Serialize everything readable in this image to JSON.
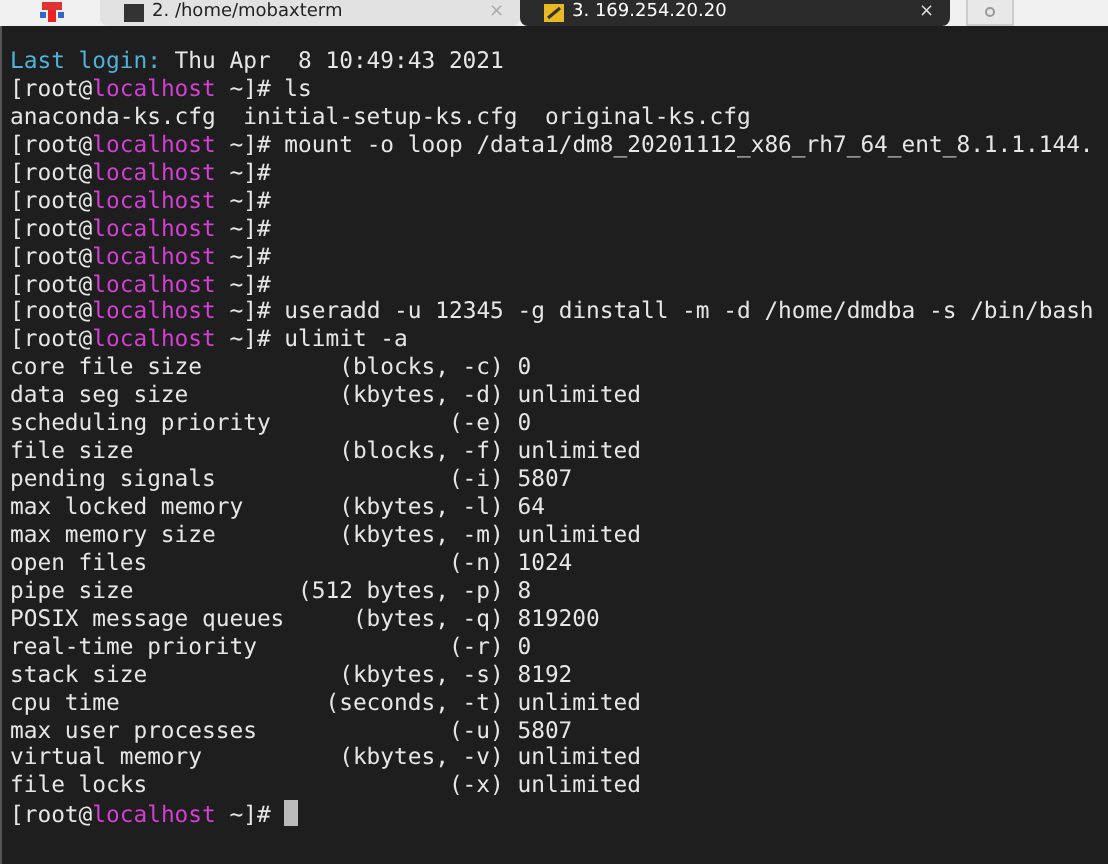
{
  "tabs": [
    {
      "label": "2. /home/mobaxterm",
      "close": "×",
      "selected": false
    },
    {
      "label": "3. 169.254.20.20",
      "close": "×",
      "selected": true
    }
  ],
  "terminal": {
    "lines": [
      {
        "kind": "login",
        "label": "Last login:",
        "text": " Thu Apr  8 10:49:43 2021"
      },
      {
        "kind": "prompt",
        "user": "[root@",
        "host": "localhost",
        "dir": " ~]# ",
        "command": "ls"
      },
      {
        "kind": "output",
        "text": "anaconda-ks.cfg  initial-setup-ks.cfg  original-ks.cfg"
      },
      {
        "kind": "prompt",
        "user": "[root@",
        "host": "localhost",
        "dir": " ~]# ",
        "command": "mount -o loop /data1/dm8_20201112_x86_rh7_64_ent_8.1.1.144."
      },
      {
        "kind": "prompt",
        "user": "[root@",
        "host": "localhost",
        "dir": " ~]#"
      },
      {
        "kind": "prompt",
        "user": "[root@",
        "host": "localhost",
        "dir": " ~]#"
      },
      {
        "kind": "prompt",
        "user": "[root@",
        "host": "localhost",
        "dir": " ~]#"
      },
      {
        "kind": "prompt",
        "user": "[root@",
        "host": "localhost",
        "dir": " ~]#"
      },
      {
        "kind": "prompt",
        "user": "[root@",
        "host": "localhost",
        "dir": " ~]#"
      },
      {
        "kind": "prompt",
        "user": "[root@",
        "host": "localhost",
        "dir": " ~]# ",
        "command": "useradd -u 12345 -g dinstall -m -d /home/dmdba -s /bin/bash"
      },
      {
        "kind": "prompt",
        "user": "[root@",
        "host": "localhost",
        "dir": " ~]# ",
        "command": "ulimit -a"
      },
      {
        "kind": "output",
        "text": "core file size          (blocks, -c) 0"
      },
      {
        "kind": "output",
        "text": "data seg size           (kbytes, -d) unlimited"
      },
      {
        "kind": "output",
        "text": "scheduling priority             (-e) 0"
      },
      {
        "kind": "output",
        "text": "file size               (blocks, -f) unlimited"
      },
      {
        "kind": "output",
        "text": "pending signals                 (-i) 5807"
      },
      {
        "kind": "output",
        "text": "max locked memory       (kbytes, -l) 64"
      },
      {
        "kind": "output",
        "text": "max memory size         (kbytes, -m) unlimited"
      },
      {
        "kind": "output",
        "text": "open files                      (-n) 1024"
      },
      {
        "kind": "output",
        "text": "pipe size            (512 bytes, -p) 8"
      },
      {
        "kind": "output",
        "text": "POSIX message queues     (bytes, -q) 819200"
      },
      {
        "kind": "output",
        "text": "real-time priority              (-r) 0"
      },
      {
        "kind": "output",
        "text": "stack size              (kbytes, -s) 8192"
      },
      {
        "kind": "output",
        "text": "cpu time               (seconds, -t) unlimited"
      },
      {
        "kind": "output",
        "text": "max user processes              (-u) 5807"
      },
      {
        "kind": "output",
        "text": "virtual memory          (kbytes, -v) unlimited"
      },
      {
        "kind": "output",
        "text": "file locks                      (-x) unlimited"
      },
      {
        "kind": "prompt",
        "user": "[root@",
        "host": "localhost",
        "dir": " ~]# ",
        "cursor": true
      }
    ]
  }
}
